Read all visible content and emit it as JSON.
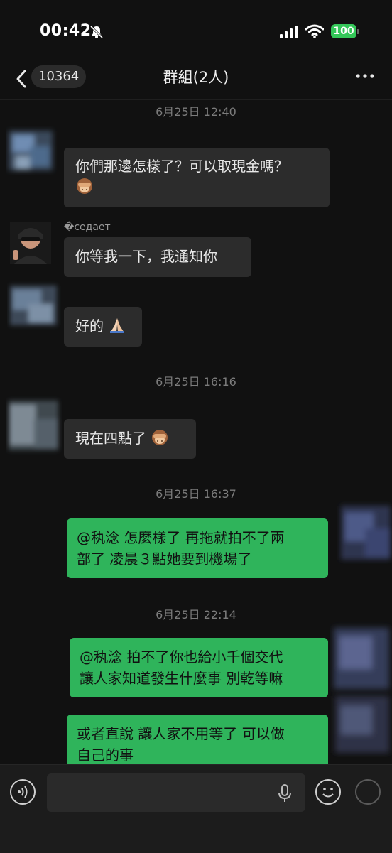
{
  "status_bar": {
    "time": "00:42",
    "battery": "100"
  },
  "nav": {
    "unread_count": "10364",
    "title": "群組(2人)"
  },
  "messages": [
    {
      "type": "timestamp",
      "text": "6月25日 12:40"
    },
    {
      "type": "in",
      "text": "你們那邊怎樣了？可以取現金嗎？",
      "emoji": "see-no-evil-monkey-icon"
    },
    {
      "type": "in",
      "sender": "�седает",
      "text": "你等我一下，我通知你"
    },
    {
      "type": "in",
      "text": "好的",
      "emoji": "praying-hands-icon"
    },
    {
      "type": "timestamp",
      "text": "6月25日 16:16"
    },
    {
      "type": "in",
      "text": "現在四點了",
      "emoji": "see-no-evil-monkey-icon"
    },
    {
      "type": "timestamp",
      "text": "6月25日 16:37"
    },
    {
      "type": "out",
      "line1": "@秇淰 怎麼樣了 再拖就拍不了兩",
      "line2": "部了 凌晨３點她要到機場了"
    },
    {
      "type": "timestamp",
      "text": "6月25日 22:14"
    },
    {
      "type": "out",
      "line1": "@秇淰 拍不了你也給小千個交代",
      "line2": "讓人家知道發生什麼事 別乾等嘛"
    },
    {
      "type": "out",
      "line1": "或者直說 讓人家不用等了 可以做",
      "line2": "自己的事"
    }
  ],
  "colors": {
    "outgoing_bubble": "#2fb45b",
    "incoming_bubble": "#2c2c2c",
    "background": "#111111"
  }
}
